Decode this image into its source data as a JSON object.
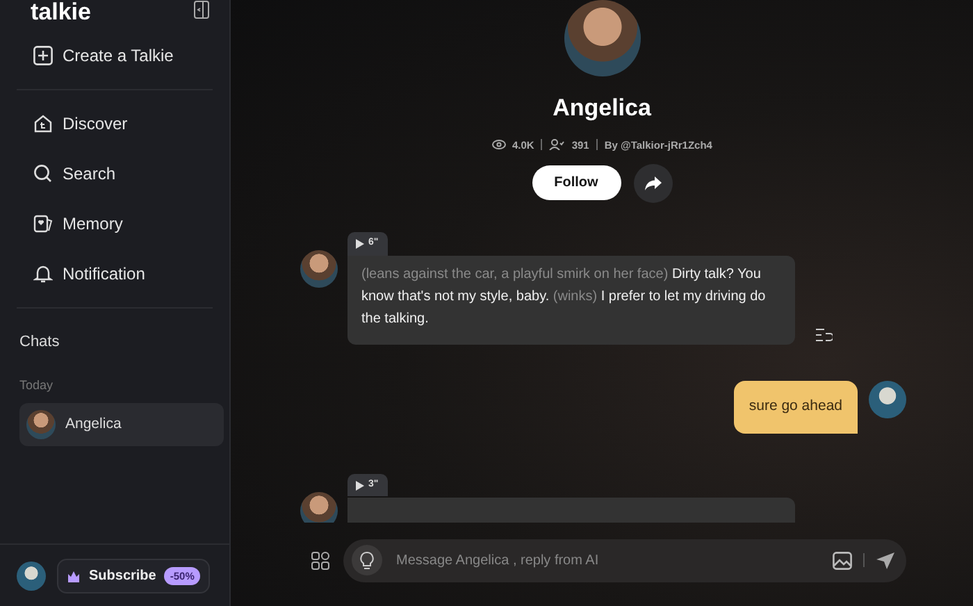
{
  "sidebar": {
    "logo": "talkie",
    "create": "Create a Talkie",
    "nav": [
      {
        "label": "Discover"
      },
      {
        "label": "Search"
      },
      {
        "label": "Memory"
      },
      {
        "label": "Notification"
      }
    ],
    "chats_heading": "Chats",
    "group_label": "Today",
    "chats": [
      {
        "name": "Angelica",
        "selected": true
      }
    ],
    "subscribe": {
      "label": "Subscribe",
      "badge": "-50%"
    }
  },
  "profile": {
    "name": "Angelica",
    "views": "4.0K",
    "followers": "391",
    "author": "By @Talkior-jRr1Zch4",
    "follow": "Follow"
  },
  "messages": [
    {
      "kind": "bot",
      "duration": "6\"",
      "segments": [
        {
          "kind": "action",
          "text": "(leans against the car, a playful smirk on her face)"
        },
        {
          "kind": "speech",
          "text": "Dirty talk? You know that's not my style, baby."
        },
        {
          "kind": "action",
          "text": "(winks)"
        },
        {
          "kind": "speech",
          "text": "I prefer to let my driving do the talking."
        }
      ]
    },
    {
      "kind": "user",
      "text": "sure go ahead"
    },
    {
      "kind": "bot",
      "duration": "3\""
    }
  ],
  "composer": {
    "placeholder": "Message Angelica , reply from AI"
  }
}
